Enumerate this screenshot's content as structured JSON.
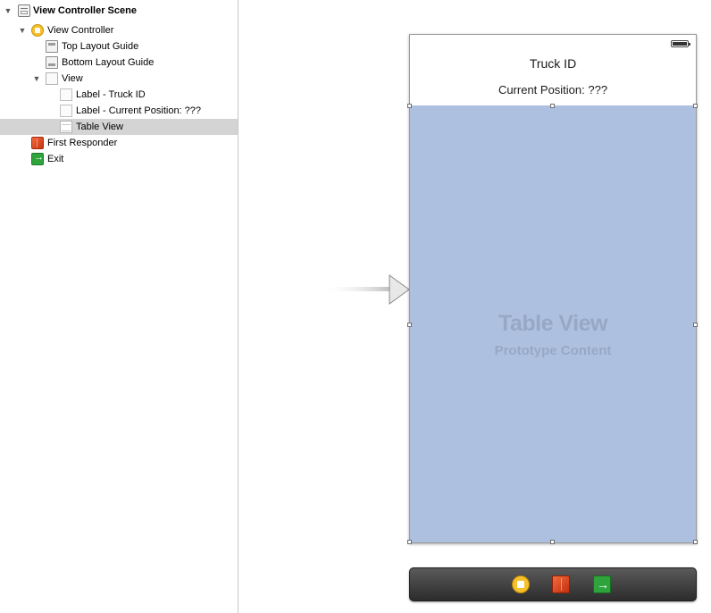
{
  "outline": {
    "items": [
      {
        "label": "View Controller Scene",
        "icon": "scene-icon",
        "bold": true
      },
      {
        "label": "View Controller",
        "icon": "view-controller-icon"
      },
      {
        "label": "Top Layout Guide",
        "icon": "layout-guide-icon"
      },
      {
        "label": "Bottom Layout Guide",
        "icon": "layout-guide-icon"
      },
      {
        "label": "View",
        "icon": "view-icon"
      },
      {
        "label": "Label - Truck ID",
        "icon": "label-icon"
      },
      {
        "label": "Label - Current Position: ???",
        "icon": "label-icon"
      },
      {
        "label": "Table View",
        "icon": "table-view-icon",
        "selected": true
      },
      {
        "label": "First Responder",
        "icon": "first-responder-icon"
      },
      {
        "label": "Exit",
        "icon": "exit-icon"
      }
    ]
  },
  "scene": {
    "truck_label": "Truck ID",
    "position_label": "Current Position: ???",
    "table_title": "Table View",
    "table_subtitle": "Prototype Content"
  },
  "dock": {
    "icons": [
      "view-controller-icon",
      "first-responder-icon",
      "exit-icon"
    ]
  },
  "colors": {
    "table_view_fill": "#aec0e0",
    "selected_row": "#d4d4d4",
    "view_controller_icon": "#f5c02a",
    "first_responder_icon": "#e24f24",
    "exit_icon": "#2fa43c"
  }
}
